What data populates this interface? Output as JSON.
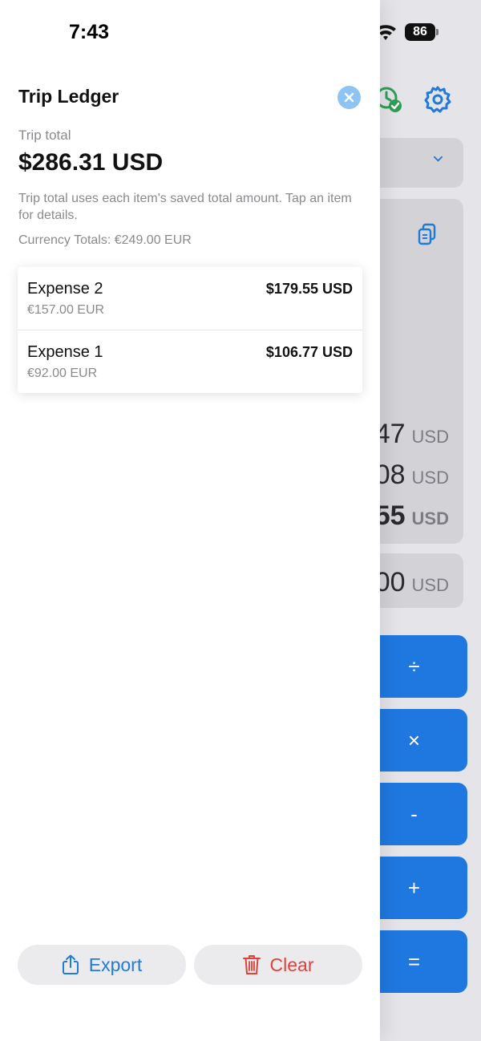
{
  "status_bar": {
    "time": "7:43",
    "battery": "86"
  },
  "background": {
    "lines": [
      {
        "num": "47",
        "cur": "USD"
      },
      {
        "num": "08",
        "cur": "USD"
      },
      {
        "num": "55",
        "cur": "USD"
      }
    ],
    "input": {
      "num": "00",
      "cur": "USD"
    },
    "operators": [
      "÷",
      "×",
      "-",
      "+",
      "="
    ]
  },
  "drawer": {
    "title": "Trip Ledger",
    "trip_total_label": "Trip total",
    "trip_total": "$286.31 USD",
    "description": "Trip total uses each item's saved total amount. Tap an item for details.",
    "currency_totals": "Currency Totals: €249.00 EUR",
    "items": [
      {
        "name": "Expense 2",
        "amount": "$179.55 USD",
        "original": "€157.00 EUR"
      },
      {
        "name": "Expense 1",
        "amount": "$106.77 USD",
        "original": "€92.00 EUR"
      }
    ],
    "export_label": "Export",
    "clear_label": "Clear"
  },
  "colors": {
    "accent": "#1f7ad8",
    "destructive": "#e0413a",
    "operator_bg": "#1f78e0"
  }
}
